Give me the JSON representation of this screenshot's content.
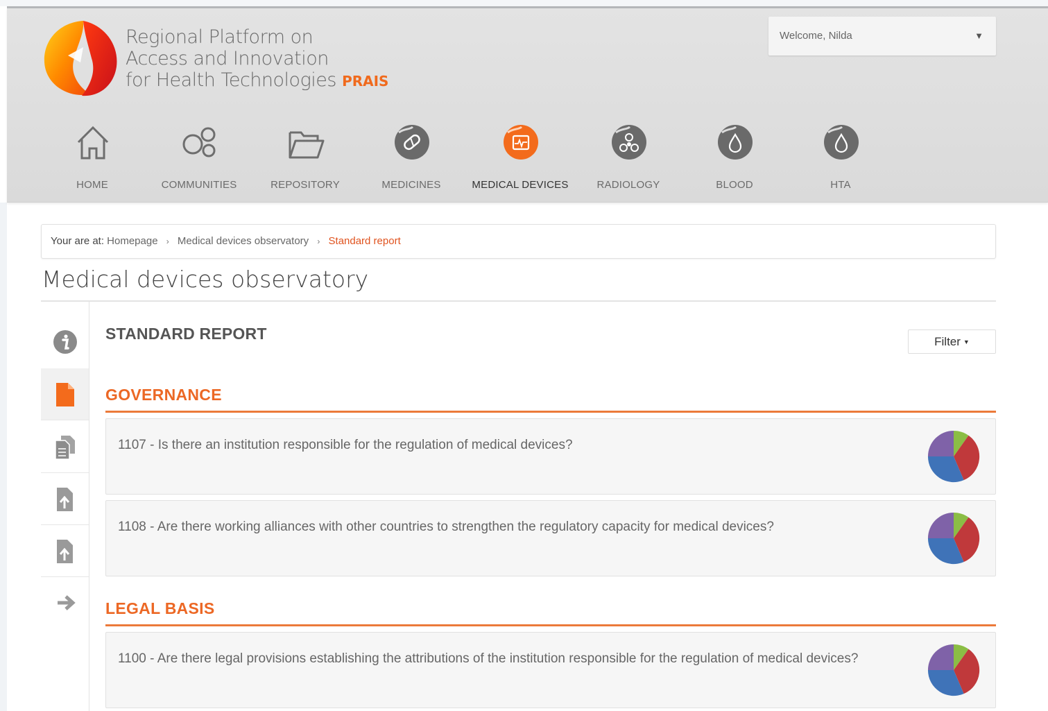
{
  "header": {
    "logo_line1": "Regional Platform on",
    "logo_line2": "Access and Innovation",
    "logo_line3": "for Health Technologies",
    "logo_brand": "PRAIS",
    "welcome": "Welcome, Nilda"
  },
  "nav": [
    {
      "label": "HOME",
      "icon": "home-icon"
    },
    {
      "label": "COMMUNITIES",
      "icon": "communities-icon"
    },
    {
      "label": "REPOSITORY",
      "icon": "folder-icon"
    },
    {
      "label": "MEDICINES",
      "icon": "pill-icon"
    },
    {
      "label": "MEDICAL DEVICES",
      "icon": "medical-device-icon",
      "active": true
    },
    {
      "label": "RADIOLOGY",
      "icon": "radiation-icon"
    },
    {
      "label": "BLOOD",
      "icon": "blood-drop-icon"
    },
    {
      "label": "HTA",
      "icon": "hta-drop-icon"
    }
  ],
  "breadcrumb": {
    "prefix": "Your are at:",
    "items": [
      "Homepage",
      "Medical devices observatory",
      "Standard report"
    ]
  },
  "page": {
    "title": "Medical devices observatory",
    "report_title": "STANDARD REPORT",
    "filter_label": "Filter"
  },
  "sidebar": [
    "info-icon",
    "document-icon",
    "copy-documents-icon",
    "upload-document-icon",
    "download-document-icon",
    "arrow-right-icon"
  ],
  "sections": [
    {
      "title": "GOVERNANCE",
      "questions": [
        {
          "text": "1107 - Is there an institution responsible for the regulation of medical devices?"
        },
        {
          "text": "1108 - Are there working alliances with other countries to strengthen the regulatory capacity for medical devices?"
        }
      ]
    },
    {
      "title": "LEGAL BASIS",
      "questions": [
        {
          "text": "1100 - Are there legal provisions establishing the attributions of the institution responsible for the regulation of medical devices?"
        }
      ]
    }
  ],
  "colors": {
    "accent": "#ec6825",
    "pie_green": "#8bbd45",
    "pie_red": "#c0393b",
    "pie_blue": "#3f73b8",
    "pie_purple": "#7f62a8"
  }
}
